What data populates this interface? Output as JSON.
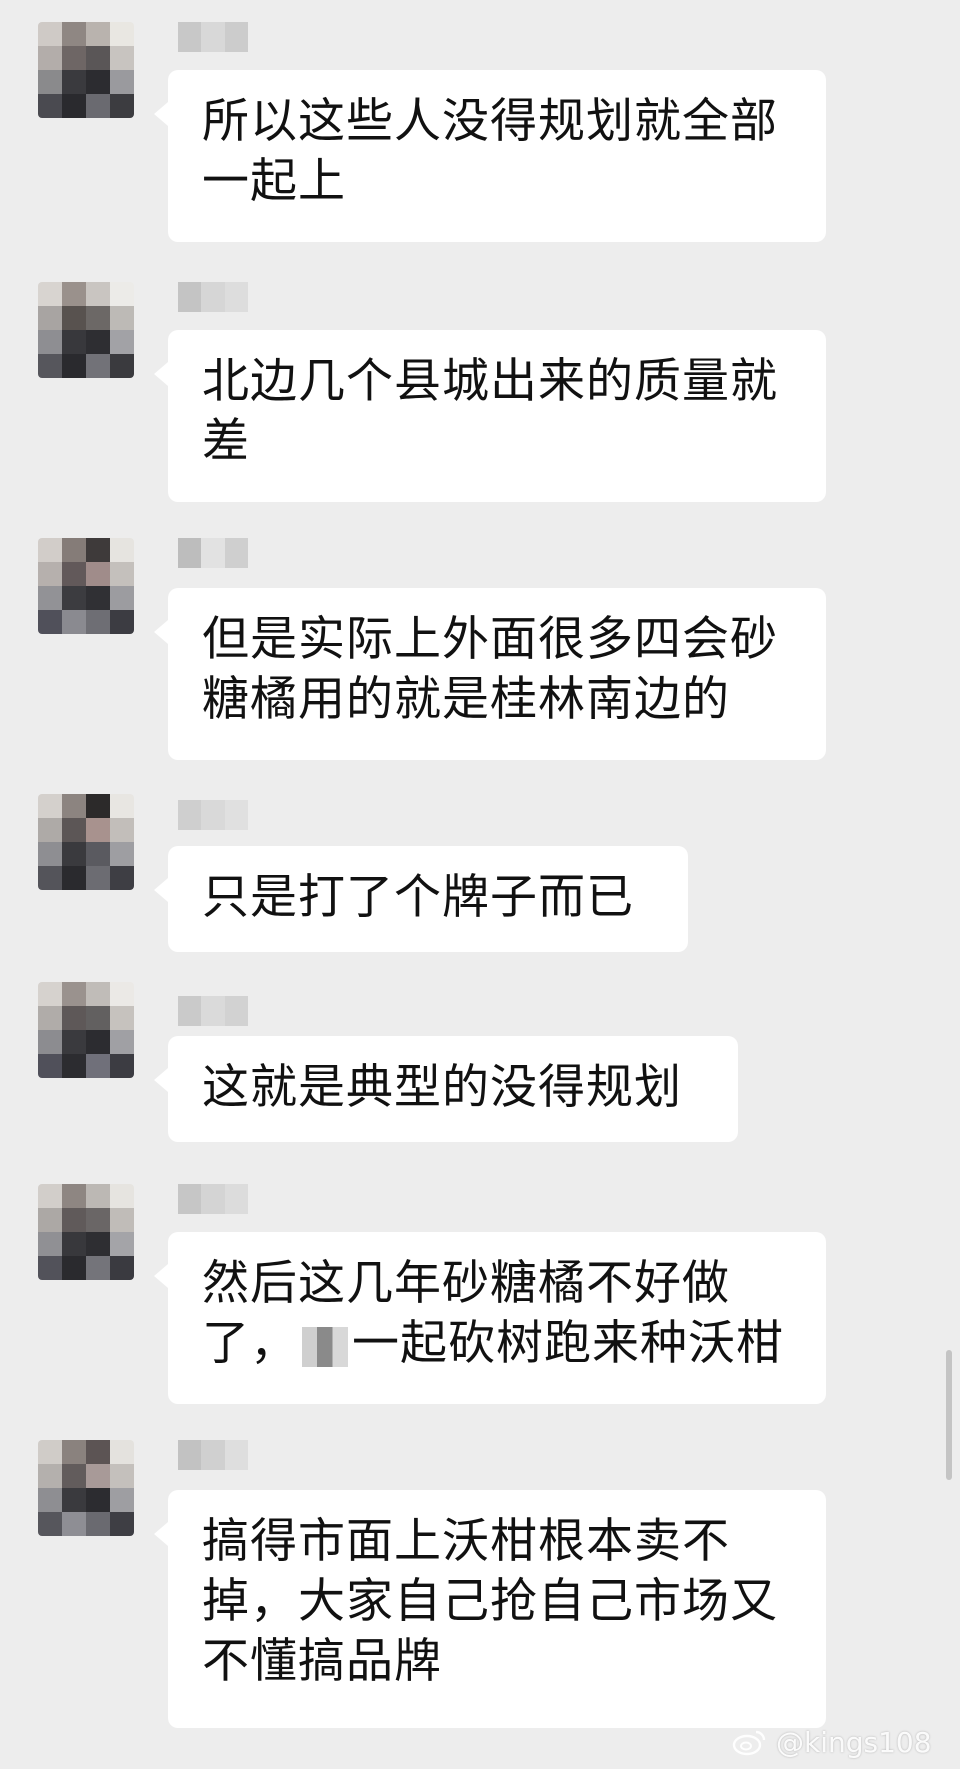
{
  "messages": [
    {
      "lines": [
        "所以这些人没得规划就全部",
        "一起上"
      ]
    },
    {
      "lines": [
        "北边几个县城出来的质量就",
        "差"
      ]
    },
    {
      "lines": [
        "但是实际上外面很多四会砂",
        "糖橘用的就是桂林南边的"
      ]
    },
    {
      "lines": [
        "只是打了个牌子而已"
      ]
    },
    {
      "lines": [
        "这就是典型的没得规划"
      ]
    },
    {
      "lines": [
        "然后这几年砂糖橘不好做",
        "了，",
        "一起砍树跑来种沃柑"
      ]
    },
    {
      "lines": [
        "搞得市面上沃柑根本卖不",
        "掉，大家自己抢自己市场又",
        "不懂搞品牌"
      ]
    }
  ],
  "watermark": {
    "text": "@kings108",
    "icon": "weibo-icon"
  },
  "colors": {
    "background": "#ededed",
    "bubble": "#ffffff",
    "text": "#111111"
  }
}
